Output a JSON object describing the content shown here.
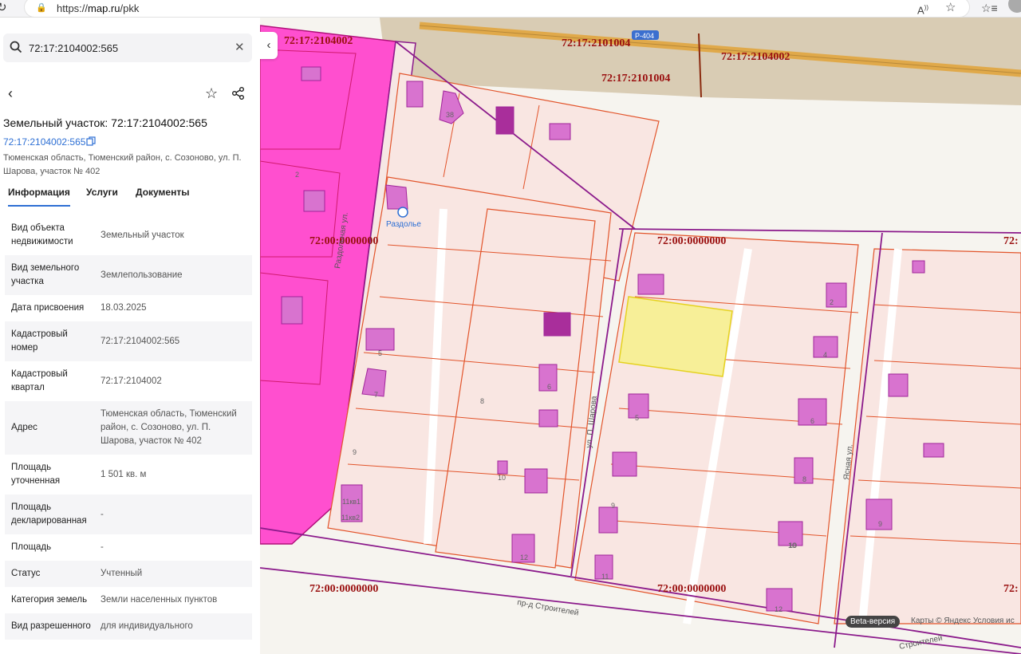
{
  "browser": {
    "url_scheme": "https://",
    "url_host": "map.ru",
    "url_path": "/pkk"
  },
  "search": {
    "value": "72:17:2104002:565"
  },
  "parcel": {
    "title": "Земельный участок: 72:17:2104002:565",
    "cad_number_link": "72:17:2104002:565",
    "address": "Тюменская область, Тюменский район, с. Созоново, ул. П. Шарова, участок № 402"
  },
  "tabs": [
    {
      "label": "Информация"
    },
    {
      "label": "Услуги"
    },
    {
      "label": "Документы"
    }
  ],
  "info": [
    {
      "key": "Вид объекта недвижимости",
      "value": "Земельный участок"
    },
    {
      "key": "Вид земельного участка",
      "value": "Землепользование"
    },
    {
      "key": "Дата присвоения",
      "value": "18.03.2025"
    },
    {
      "key": "Кадастровый номер",
      "value": "72:17:2104002:565"
    },
    {
      "key": "Кадастровый квартал",
      "value": "72:17:2104002"
    },
    {
      "key": "Адрес",
      "value": "Тюменская область, Тюменский район, с. Созоново, ул. П. Шарова, участок № 402"
    },
    {
      "key": "Площадь уточненная",
      "value": "1 501 кв. м"
    },
    {
      "key": "Площадь декларированная",
      "value": "-"
    },
    {
      "key": "Площадь",
      "value": "-"
    },
    {
      "key": "Статус",
      "value": "Учтенный"
    },
    {
      "key": "Категория земель",
      "value": "Земли населенных пунктов"
    },
    {
      "key": "Вид разрешенного",
      "value": "для индивидуального"
    }
  ],
  "map": {
    "quarter_labels": [
      "72:17:2104002",
      "72:17:2101004",
      "72:17:2101004",
      "72:17:2104002",
      "72:00:0000000",
      "72:00:0000000",
      "72:00:0000000",
      "72:00:0000000",
      "72:",
      "72:"
    ],
    "road_badge": "Р-404",
    "place_label": "Раздолье",
    "street_labels": [
      "ул. П. Шарова",
      "Раздольная ул.",
      "Ясная ул.",
      "пр-д Строителей",
      "Строителей"
    ],
    "house_numbers": [
      "38",
      "2",
      "5",
      "6",
      "7",
      "8",
      "9",
      "10",
      "11кв1",
      "11кв2",
      "12",
      "9",
      "10",
      "11",
      "5",
      "2",
      "4",
      "6",
      "8",
      "10",
      "12",
      "9"
    ],
    "beta_label": "Beta-версия",
    "attribution": "Карты © Яндекс  Условия ис",
    "colors": {
      "parcel_fill": "#f9e6e2",
      "parcel_border": "#e2542b",
      "quarter_border": "#8b1a8b",
      "selected_fill": "#f7ef98",
      "building_fill": "#d873cf",
      "zone_fill": "#ff4fcf",
      "label_color": "#9a1010"
    }
  }
}
